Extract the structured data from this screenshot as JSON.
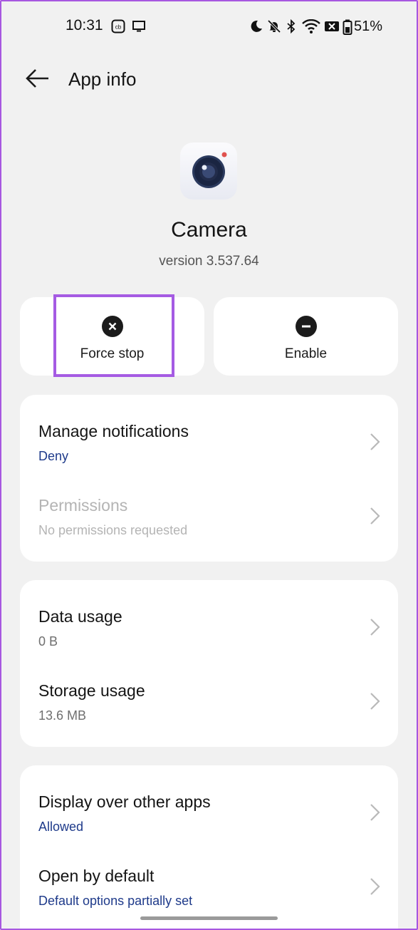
{
  "status_bar": {
    "time": "10:31",
    "battery_percent": "51%",
    "icons": [
      "cb-app-icon",
      "screen-icon",
      "moon-icon",
      "bell-off-icon",
      "bluetooth-icon",
      "wifi-icon",
      "sim-off-icon",
      "battery-icon"
    ]
  },
  "header": {
    "back_icon": "arrow-left-icon",
    "title": "App info"
  },
  "app": {
    "icon": "camera-app-icon",
    "name": "Camera",
    "version": "version 3.537.64"
  },
  "actions": [
    {
      "label": "Force stop",
      "icon": "close-circle-icon",
      "highlighted": true
    },
    {
      "label": "Enable",
      "icon": "minus-circle-icon",
      "highlighted": false
    }
  ],
  "sections": [
    {
      "rows": [
        {
          "title": "Manage notifications",
          "subtitle": "Deny",
          "disabled": false
        },
        {
          "title": "Permissions",
          "subtitle": "No permissions requested",
          "disabled": true
        }
      ]
    },
    {
      "rows": [
        {
          "title": "Data usage",
          "subtitle": "0 B",
          "disabled": false
        },
        {
          "title": "Storage usage",
          "subtitle": "13.6 MB",
          "disabled": false
        }
      ]
    },
    {
      "rows": [
        {
          "title": "Display over other apps",
          "subtitle": "Allowed",
          "disabled": false
        },
        {
          "title": "Open by default",
          "subtitle": "Default options partially set",
          "disabled": false
        }
      ]
    }
  ],
  "colors": {
    "background": "#f1f1f1",
    "card": "#ffffff",
    "highlight": "#a55be3",
    "link_blue": "#1e3a8a",
    "disabled_gray": "#b4b4b4"
  }
}
